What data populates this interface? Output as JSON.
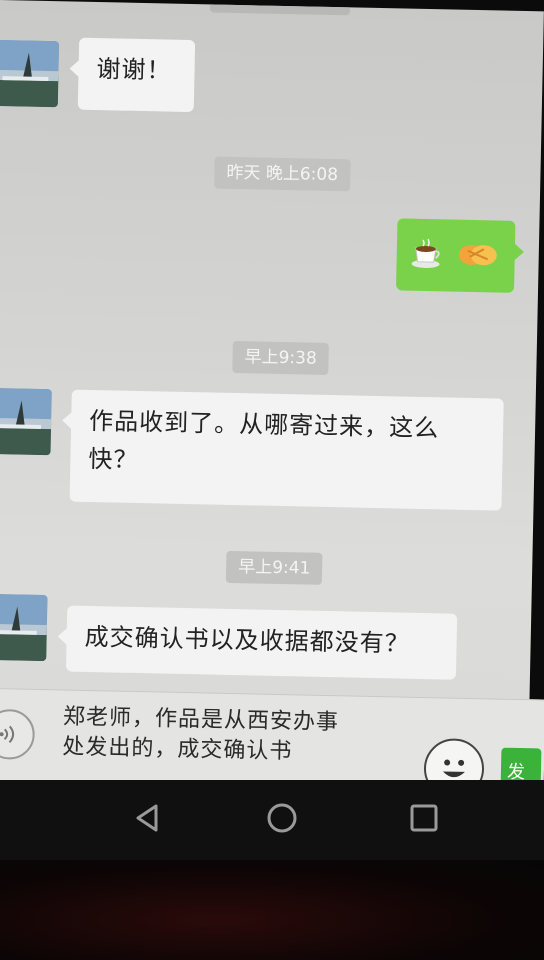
{
  "chat": {
    "messages": [
      {
        "side": "left",
        "text": "谢谢！"
      },
      {
        "side": "right",
        "emoji": [
          "coffee-icon",
          "handshake-icon"
        ]
      },
      {
        "side": "left",
        "text": "作品收到了。从哪寄过来，这么快？"
      },
      {
        "side": "left",
        "text": "成交确认书以及收据都没有？"
      }
    ],
    "timestamps": [
      "昨天 晚上6:08",
      "早上9:38",
      "早上9:41"
    ]
  },
  "input": {
    "line1": "郑老师，作品是从西安办事",
    "line2": "处发出的，成交确认书",
    "send_label": "发"
  },
  "colors": {
    "bubble_green": "#79d24a",
    "send_green": "#3bb33a",
    "chat_bg": "#d6d6d4"
  },
  "icons": {
    "voice": "voice-icon",
    "emoji": "smiley-icon",
    "nav_back": "back-triangle-icon",
    "nav_home": "home-circle-icon",
    "nav_recent": "recent-square-icon"
  }
}
